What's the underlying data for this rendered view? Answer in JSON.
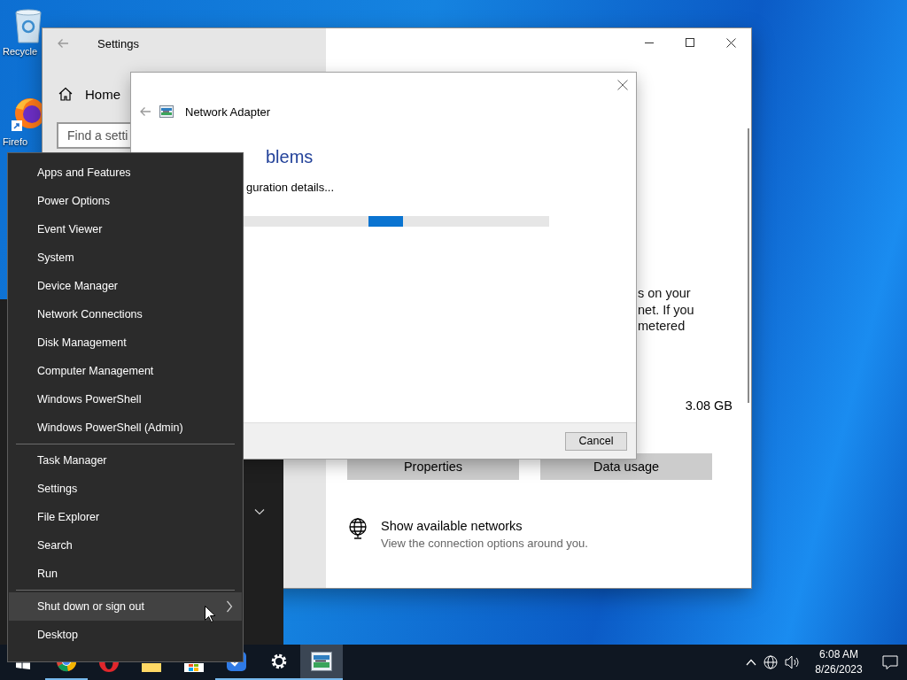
{
  "desktop_icons": [
    {
      "kind": "bin",
      "label": "Recycle"
    },
    {
      "kind": "browser",
      "label": "Firefo"
    }
  ],
  "settings_window": {
    "title": "Settings",
    "home": "Home",
    "search": {
      "placeholder": "Find a setti"
    },
    "description_lines": [
      "s on your",
      "net. If you",
      "metered"
    ],
    "data_amount": "3.08 GB",
    "buttons": [
      "Properties",
      "Data usage"
    ],
    "network_link": {
      "title": "Show available networks",
      "subtitle": "View the connection options around you."
    }
  },
  "dialog": {
    "title": "Network Adapter",
    "heading": "blems",
    "status": "guration details...",
    "buttons": [
      "Cancel"
    ]
  },
  "context_menu": {
    "sections": [
      {
        "items": [
          {
            "label": "Apps and Features",
            "selected": false,
            "submenu": false
          },
          {
            "label": "Power Options",
            "selected": false,
            "submenu": false
          },
          {
            "label": "Event Viewer",
            "selected": false,
            "submenu": false
          },
          {
            "label": "System",
            "selected": false,
            "submenu": false
          },
          {
            "label": "Device Manager",
            "selected": false,
            "submenu": false
          },
          {
            "label": "Network Connections",
            "selected": false,
            "submenu": false
          },
          {
            "label": "Disk Management",
            "selected": false,
            "submenu": false
          },
          {
            "label": "Computer Management",
            "selected": false,
            "submenu": false
          },
          {
            "label": "Windows PowerShell",
            "selected": false,
            "submenu": false
          },
          {
            "label": "Windows PowerShell (Admin)",
            "selected": false,
            "submenu": false
          }
        ]
      },
      {
        "items": [
          {
            "label": "Task Manager",
            "selected": false,
            "submenu": false
          },
          {
            "label": "Settings",
            "selected": false,
            "submenu": false
          },
          {
            "label": "File Explorer",
            "selected": false,
            "submenu": false
          },
          {
            "label": "Search",
            "selected": false,
            "submenu": false
          },
          {
            "label": "Run",
            "selected": false,
            "submenu": false
          }
        ]
      },
      {
        "items": [
          {
            "label": "Shut down or sign out",
            "selected": true,
            "submenu": true
          },
          {
            "label": "Desktop",
            "selected": false,
            "submenu": false
          }
        ]
      }
    ]
  },
  "taskbar": {
    "apps": [
      {
        "kind": "start",
        "selected": false,
        "running": false
      },
      {
        "kind": "browser-round",
        "selected": false,
        "running": true
      },
      {
        "kind": "browser-red",
        "selected": false,
        "running": false
      },
      {
        "kind": "folder",
        "selected": false,
        "running": false
      },
      {
        "kind": "store",
        "selected": false,
        "running": false
      },
      {
        "kind": "check",
        "selected": false,
        "running": true
      },
      {
        "kind": "gear",
        "selected": false,
        "running": true
      },
      {
        "kind": "adapter",
        "selected": true,
        "running": true
      }
    ],
    "clock": {
      "time": "6:08 AM",
      "date": "8/26/2023"
    }
  }
}
